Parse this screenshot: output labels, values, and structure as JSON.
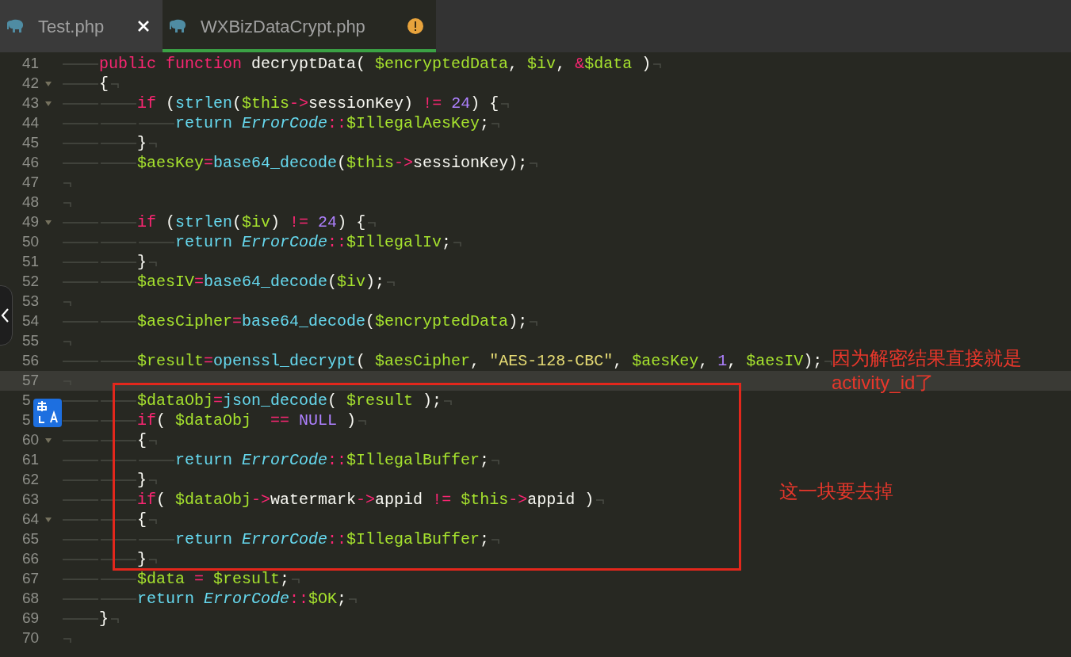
{
  "tabs": [
    {
      "label": "Test.php",
      "selected": false,
      "closable": true,
      "warning": false
    },
    {
      "label": "WXBizDataCrypt.php",
      "selected": true,
      "closable": false,
      "warning": true
    }
  ],
  "editor": {
    "lines": [
      {
        "number": "41",
        "fold": false,
        "current": false,
        "tokens": [
          {
            "kind": "tab"
          },
          {
            "kind": "kw",
            "text": "public function "
          },
          {
            "kind": "plain",
            "text": "decryptData( "
          },
          {
            "kind": "var",
            "text": "$encryptedData"
          },
          {
            "kind": "plain",
            "text": ", "
          },
          {
            "kind": "var",
            "text": "$iv"
          },
          {
            "kind": "plain",
            "text": ", "
          },
          {
            "kind": "op",
            "text": "&"
          },
          {
            "kind": "var",
            "text": "$data"
          },
          {
            "kind": "plain",
            "text": " )"
          }
        ]
      },
      {
        "number": "42",
        "fold": true,
        "current": false,
        "tokens": [
          {
            "kind": "tab"
          },
          {
            "kind": "plain",
            "text": "{"
          }
        ]
      },
      {
        "number": "43",
        "fold": true,
        "current": false,
        "tokens": [
          {
            "kind": "tab"
          },
          {
            "kind": "tab"
          },
          {
            "kind": "kw",
            "text": "if"
          },
          {
            "kind": "plain",
            "text": " ("
          },
          {
            "kind": "fn",
            "text": "strlen"
          },
          {
            "kind": "plain",
            "text": "("
          },
          {
            "kind": "var",
            "text": "$this"
          },
          {
            "kind": "op",
            "text": "->"
          },
          {
            "kind": "plain",
            "text": "sessionKey) "
          },
          {
            "kind": "op",
            "text": "!="
          },
          {
            "kind": "num",
            "text": " 24"
          },
          {
            "kind": "plain",
            "text": ") {"
          }
        ]
      },
      {
        "number": "44",
        "fold": false,
        "current": false,
        "tokens": [
          {
            "kind": "tab"
          },
          {
            "kind": "tab"
          },
          {
            "kind": "tab"
          },
          {
            "kind": "fn",
            "text": "return "
          },
          {
            "kind": "cls",
            "text": "ErrorCode"
          },
          {
            "kind": "op",
            "text": "::"
          },
          {
            "kind": "var",
            "text": "$IllegalAesKey"
          },
          {
            "kind": "plain",
            "text": ";"
          }
        ]
      },
      {
        "number": "45",
        "fold": false,
        "current": false,
        "tokens": [
          {
            "kind": "tab"
          },
          {
            "kind": "tab"
          },
          {
            "kind": "plain",
            "text": "}"
          }
        ]
      },
      {
        "number": "46",
        "fold": false,
        "current": false,
        "tokens": [
          {
            "kind": "tab"
          },
          {
            "kind": "tab"
          },
          {
            "kind": "var",
            "text": "$aesKey"
          },
          {
            "kind": "op",
            "text": "="
          },
          {
            "kind": "fn",
            "text": "base64_decode"
          },
          {
            "kind": "plain",
            "text": "("
          },
          {
            "kind": "var",
            "text": "$this"
          },
          {
            "kind": "op",
            "text": "->"
          },
          {
            "kind": "plain",
            "text": "sessionKey);"
          }
        ]
      },
      {
        "number": "47",
        "fold": false,
        "current": false
      },
      {
        "number": "48",
        "fold": false,
        "current": false
      },
      {
        "number": "49",
        "fold": true,
        "current": false,
        "tokens": [
          {
            "kind": "tab"
          },
          {
            "kind": "tab"
          },
          {
            "kind": "kw",
            "text": "if"
          },
          {
            "kind": "plain",
            "text": " ("
          },
          {
            "kind": "fn",
            "text": "strlen"
          },
          {
            "kind": "plain",
            "text": "("
          },
          {
            "kind": "var",
            "text": "$iv"
          },
          {
            "kind": "plain",
            "text": ") "
          },
          {
            "kind": "op",
            "text": "!="
          },
          {
            "kind": "num",
            "text": " 24"
          },
          {
            "kind": "plain",
            "text": ") {"
          }
        ]
      },
      {
        "number": "50",
        "fold": false,
        "current": false,
        "tokens": [
          {
            "kind": "tab"
          },
          {
            "kind": "tab"
          },
          {
            "kind": "tab"
          },
          {
            "kind": "fn",
            "text": "return "
          },
          {
            "kind": "cls",
            "text": "ErrorCode"
          },
          {
            "kind": "op",
            "text": "::"
          },
          {
            "kind": "var",
            "text": "$IllegalIv"
          },
          {
            "kind": "plain",
            "text": ";"
          }
        ]
      },
      {
        "number": "51",
        "fold": false,
        "current": false,
        "tokens": [
          {
            "kind": "tab"
          },
          {
            "kind": "tab"
          },
          {
            "kind": "plain",
            "text": "}"
          }
        ]
      },
      {
        "number": "52",
        "fold": false,
        "current": false,
        "tokens": [
          {
            "kind": "tab"
          },
          {
            "kind": "tab"
          },
          {
            "kind": "var",
            "text": "$aesIV"
          },
          {
            "kind": "op",
            "text": "="
          },
          {
            "kind": "fn",
            "text": "base64_decode"
          },
          {
            "kind": "plain",
            "text": "("
          },
          {
            "kind": "var",
            "text": "$iv"
          },
          {
            "kind": "plain",
            "text": ");"
          }
        ]
      },
      {
        "number": "53",
        "fold": false,
        "current": false
      },
      {
        "number": "54",
        "fold": false,
        "current": false,
        "tokens": [
          {
            "kind": "tab"
          },
          {
            "kind": "tab"
          },
          {
            "kind": "var",
            "text": "$aesCipher"
          },
          {
            "kind": "op",
            "text": "="
          },
          {
            "kind": "fn",
            "text": "base64_decode"
          },
          {
            "kind": "plain",
            "text": "("
          },
          {
            "kind": "var",
            "text": "$encryptedData"
          },
          {
            "kind": "plain",
            "text": ");"
          }
        ]
      },
      {
        "number": "55",
        "fold": false,
        "current": false
      },
      {
        "number": "56",
        "fold": false,
        "current": false,
        "tokens": [
          {
            "kind": "tab"
          },
          {
            "kind": "tab"
          },
          {
            "kind": "var",
            "text": "$result"
          },
          {
            "kind": "op",
            "text": "="
          },
          {
            "kind": "fn",
            "text": "openssl_decrypt"
          },
          {
            "kind": "plain",
            "text": "( "
          },
          {
            "kind": "var",
            "text": "$aesCipher"
          },
          {
            "kind": "plain",
            "text": ", "
          },
          {
            "kind": "str",
            "text": "\"AES-128-CBC\""
          },
          {
            "kind": "plain",
            "text": ", "
          },
          {
            "kind": "var",
            "text": "$aesKey"
          },
          {
            "kind": "plain",
            "text": ", "
          },
          {
            "kind": "num",
            "text": "1"
          },
          {
            "kind": "plain",
            "text": ", "
          },
          {
            "kind": "var",
            "text": "$aesIV"
          },
          {
            "kind": "plain",
            "text": ");"
          }
        ]
      },
      {
        "number": "57",
        "fold": false,
        "current": true
      },
      {
        "number": "5",
        "current": false,
        "tokens": [
          {
            "kind": "tab"
          },
          {
            "kind": "tab"
          },
          {
            "kind": "var",
            "text": "$dataObj"
          },
          {
            "kind": "op",
            "text": "="
          },
          {
            "kind": "fn",
            "text": "json_decode"
          },
          {
            "kind": "plain",
            "text": "( "
          },
          {
            "kind": "var",
            "text": "$result"
          },
          {
            "kind": "plain",
            "text": " );"
          }
        ]
      },
      {
        "number": "5",
        "current": false,
        "tokens": [
          {
            "kind": "tab"
          },
          {
            "kind": "tab"
          },
          {
            "kind": "kw",
            "text": "if"
          },
          {
            "kind": "plain",
            "text": "( "
          },
          {
            "kind": "var",
            "text": "$dataObj  "
          },
          {
            "kind": "op",
            "text": "=="
          },
          {
            "kind": "num",
            "text": " NULL"
          },
          {
            "kind": "plain",
            "text": " )"
          }
        ]
      },
      {
        "number": "60",
        "fold": true,
        "current": false,
        "tokens": [
          {
            "kind": "tab"
          },
          {
            "kind": "tab"
          },
          {
            "kind": "plain",
            "text": "{"
          }
        ]
      },
      {
        "number": "61",
        "fold": false,
        "current": false,
        "tokens": [
          {
            "kind": "tab"
          },
          {
            "kind": "tab"
          },
          {
            "kind": "tab"
          },
          {
            "kind": "fn",
            "text": "return "
          },
          {
            "kind": "cls",
            "text": "ErrorCode"
          },
          {
            "kind": "op",
            "text": "::"
          },
          {
            "kind": "var",
            "text": "$IllegalBuffer"
          },
          {
            "kind": "plain",
            "text": ";"
          }
        ]
      },
      {
        "number": "62",
        "fold": false,
        "current": false,
        "tokens": [
          {
            "kind": "tab"
          },
          {
            "kind": "tab"
          },
          {
            "kind": "plain",
            "text": "}"
          }
        ]
      },
      {
        "number": "63",
        "fold": false,
        "current": false,
        "tokens": [
          {
            "kind": "tab"
          },
          {
            "kind": "tab"
          },
          {
            "kind": "kw",
            "text": "if"
          },
          {
            "kind": "plain",
            "text": "( "
          },
          {
            "kind": "var",
            "text": "$dataObj"
          },
          {
            "kind": "op",
            "text": "->"
          },
          {
            "kind": "plain",
            "text": "watermark"
          },
          {
            "kind": "op",
            "text": "->"
          },
          {
            "kind": "plain",
            "text": "appid "
          },
          {
            "kind": "op",
            "text": "!="
          },
          {
            "kind": "var",
            "text": " $this"
          },
          {
            "kind": "op",
            "text": "->"
          },
          {
            "kind": "plain",
            "text": "appid )"
          }
        ]
      },
      {
        "number": "64",
        "fold": true,
        "current": false,
        "tokens": [
          {
            "kind": "tab"
          },
          {
            "kind": "tab"
          },
          {
            "kind": "plain",
            "text": "{"
          }
        ]
      },
      {
        "number": "65",
        "fold": false,
        "current": false,
        "tokens": [
          {
            "kind": "tab"
          },
          {
            "kind": "tab"
          },
          {
            "kind": "tab"
          },
          {
            "kind": "fn",
            "text": "return "
          },
          {
            "kind": "cls",
            "text": "ErrorCode"
          },
          {
            "kind": "op",
            "text": "::"
          },
          {
            "kind": "var",
            "text": "$IllegalBuffer"
          },
          {
            "kind": "plain",
            "text": ";"
          }
        ]
      },
      {
        "number": "66",
        "fold": false,
        "current": false,
        "tokens": [
          {
            "kind": "tab"
          },
          {
            "kind": "tab"
          },
          {
            "kind": "plain",
            "text": "}"
          }
        ]
      },
      {
        "number": "67",
        "fold": false,
        "current": false,
        "tokens": [
          {
            "kind": "tab"
          },
          {
            "kind": "tab"
          },
          {
            "kind": "var",
            "text": "$data"
          },
          {
            "kind": "op",
            "text": " ="
          },
          {
            "kind": "var",
            "text": " $result"
          },
          {
            "kind": "plain",
            "text": ";"
          }
        ]
      },
      {
        "number": "68",
        "fold": false,
        "current": false,
        "tokens": [
          {
            "kind": "tab"
          },
          {
            "kind": "tab"
          },
          {
            "kind": "fn",
            "text": "return "
          },
          {
            "kind": "cls",
            "text": "ErrorCode"
          },
          {
            "kind": "op",
            "text": "::"
          },
          {
            "kind": "var",
            "text": "$OK"
          },
          {
            "kind": "plain",
            "text": ";"
          }
        ]
      },
      {
        "number": "69",
        "fold": false,
        "current": false,
        "tokens": [
          {
            "kind": "tab"
          },
          {
            "kind": "plain",
            "text": "}"
          }
        ]
      },
      {
        "number": "70",
        "fold": false,
        "current": false
      }
    ]
  },
  "annotations": [
    {
      "kind": "note",
      "lines": [
        "因为解密结果直接就是",
        "activity_id了"
      ]
    },
    {
      "kind": "note",
      "lines": [
        "这一块要去掉"
      ]
    }
  ]
}
